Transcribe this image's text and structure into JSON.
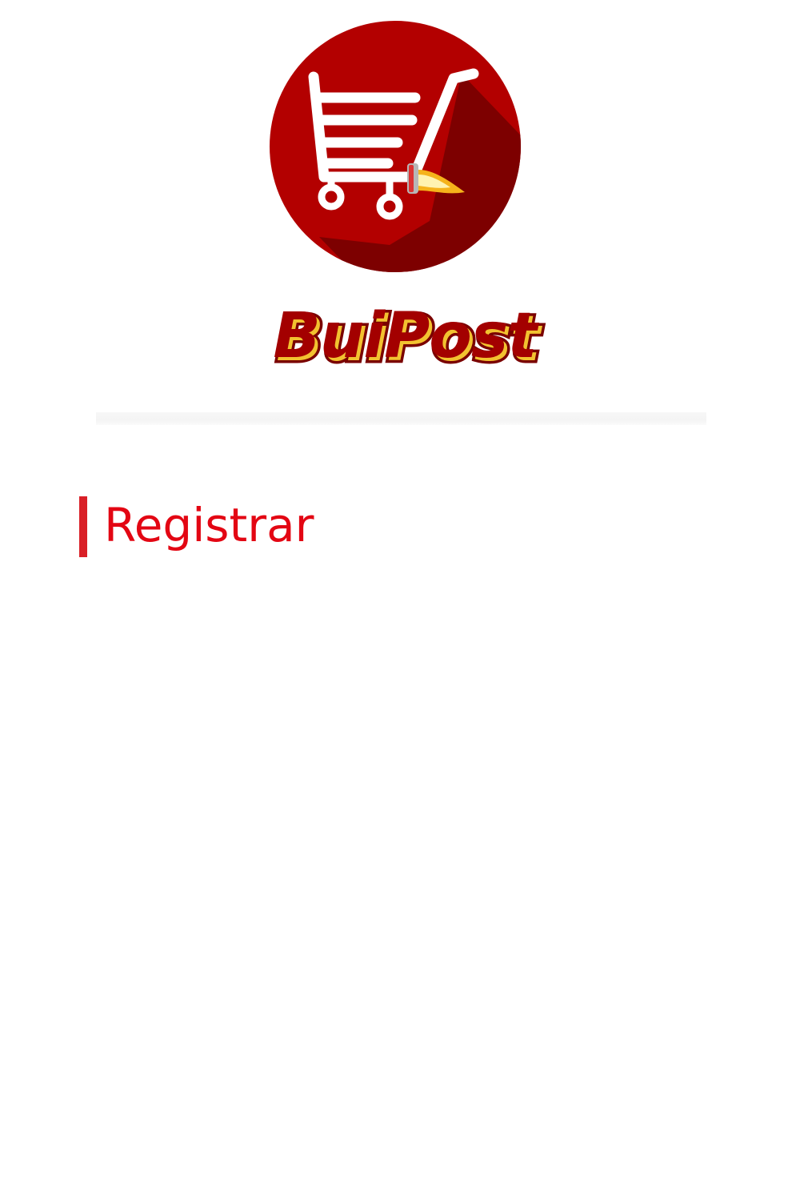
{
  "brand": {
    "name": "BuiPost",
    "colors": {
      "circle": "#b00000",
      "shadow": "#7a0000",
      "text_fill": "#a30000",
      "text_outline": "#f2c230",
      "flame": "#f5b31b"
    },
    "logo_icon": "shopping-cart-rocket-icon"
  },
  "section": {
    "title": "Registrar",
    "accent_color": "#d92027",
    "title_color": "#e30613"
  }
}
